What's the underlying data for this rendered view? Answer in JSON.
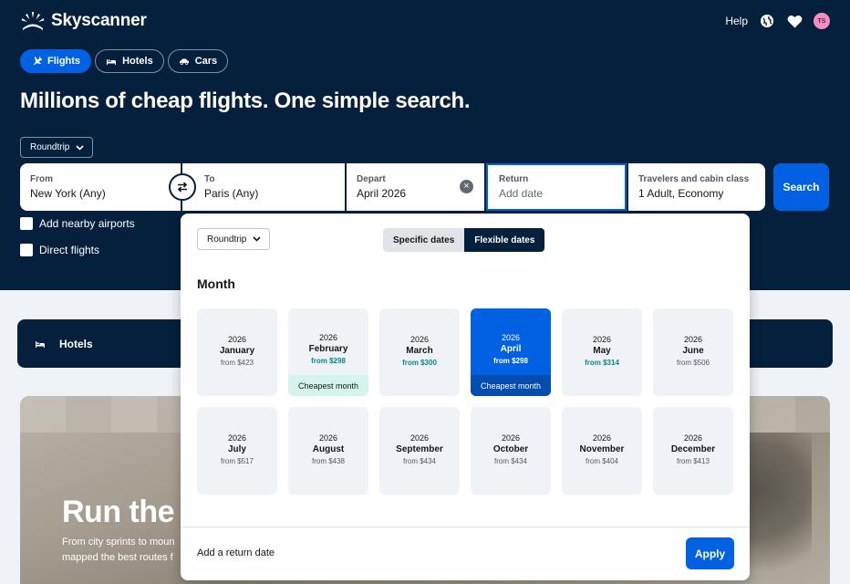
{
  "brand": {
    "name": "Skyscanner"
  },
  "topnav": {
    "help": "Help",
    "avatar_initials": "TS"
  },
  "tabs": [
    {
      "label": "Flights",
      "icon": "plane-icon",
      "active": true
    },
    {
      "label": "Hotels",
      "icon": "bed-icon",
      "active": false
    },
    {
      "label": "Cars",
      "icon": "car-icon",
      "active": false
    }
  ],
  "headline": "Millions of cheap flights. One simple search.",
  "trip_type": "Roundtrip",
  "search": {
    "from_label": "From",
    "from_value": "New York (Any)",
    "to_label": "To",
    "to_value": "Paris (Any)",
    "depart_label": "Depart",
    "depart_value": "April 2026",
    "return_label": "Return",
    "return_placeholder": "Add date",
    "travelers_label": "Travelers and cabin class",
    "travelers_value": "1 Adult, Economy",
    "button": "Search"
  },
  "options": {
    "nearby": "Add nearby airports",
    "direct": "Direct flights"
  },
  "hotels_card": {
    "label": "Hotels"
  },
  "promo": {
    "title": "Run the W",
    "subtitle": "From city sprints to moun mapped the best routes f"
  },
  "panel": {
    "trip_type": "Roundtrip",
    "specific": "Specific dates",
    "flexible": "Flexible dates",
    "month_heading": "Month",
    "footer_msg": "Add a return date",
    "apply": "Apply",
    "months": [
      {
        "year": "2026",
        "name": "January",
        "price": "from $423",
        "cheap": false,
        "tag": "",
        "selected": false
      },
      {
        "year": "2026",
        "name": "February",
        "price": "from $298",
        "cheap": true,
        "tag": "Cheapest month",
        "selected": false
      },
      {
        "year": "2026",
        "name": "March",
        "price": "from $300",
        "cheap": true,
        "tag": "",
        "selected": false
      },
      {
        "year": "2026",
        "name": "April",
        "price": "from $298",
        "cheap": true,
        "tag": "Cheapest month",
        "selected": true
      },
      {
        "year": "2026",
        "name": "May",
        "price": "from $314",
        "cheap": true,
        "tag": "",
        "selected": false
      },
      {
        "year": "2026",
        "name": "June",
        "price": "from $506",
        "cheap": false,
        "tag": "",
        "selected": false
      },
      {
        "year": "2026",
        "name": "July",
        "price": "from $517",
        "cheap": false,
        "tag": "",
        "selected": false
      },
      {
        "year": "2026",
        "name": "August",
        "price": "from $438",
        "cheap": false,
        "tag": "",
        "selected": false
      },
      {
        "year": "2026",
        "name": "September",
        "price": "from $434",
        "cheap": false,
        "tag": "",
        "selected": false
      },
      {
        "year": "2026",
        "name": "October",
        "price": "from $434",
        "cheap": false,
        "tag": "",
        "selected": false
      },
      {
        "year": "2026",
        "name": "November",
        "price": "from $404",
        "cheap": false,
        "tag": "",
        "selected": false
      },
      {
        "year": "2026",
        "name": "December",
        "price": "from $413",
        "cheap": false,
        "tag": "",
        "selected": false
      }
    ]
  },
  "colors": {
    "navy": "#05203c",
    "accent": "#0062e3",
    "cheap_text": "#0c838a",
    "cheap_tag_bg": "#d4f5ef"
  }
}
